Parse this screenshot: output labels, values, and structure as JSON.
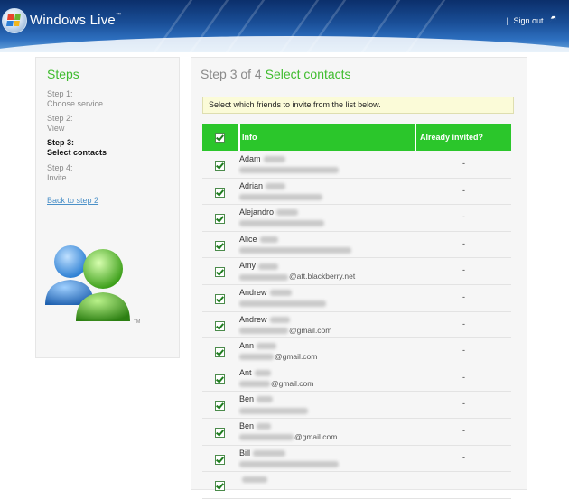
{
  "header": {
    "brand": "Windows Live",
    "brand_tm": "™",
    "separator": "|",
    "signout_label": "Sign out",
    "signout_icon": "signout-arrow-icon"
  },
  "steps": {
    "title": "Steps",
    "items": [
      {
        "label": "Step 1:",
        "desc": "Choose service",
        "active": false
      },
      {
        "label": "Step 2:",
        "desc": "View",
        "active": false
      },
      {
        "label": "Step 3:",
        "desc": "Select contacts",
        "active": true
      },
      {
        "label": "Step 4:",
        "desc": "Invite",
        "active": false
      }
    ],
    "back_link": "Back to step 2"
  },
  "main": {
    "title_prefix": "Step 3 of 4",
    "title_highlight": "Select contacts",
    "notice": "Select which friends to invite from the list below.",
    "columns": {
      "info": "Info",
      "invited": "Already invited?"
    },
    "contacts": [
      {
        "first": "Adam",
        "email_suffix": "",
        "invited": "-",
        "checked": true
      },
      {
        "first": "Adrian",
        "email_suffix": "",
        "invited": "-",
        "checked": true
      },
      {
        "first": "Alejandro",
        "email_suffix": "",
        "invited": "-",
        "checked": true
      },
      {
        "first": "Alice",
        "email_suffix": "",
        "invited": "-",
        "checked": true
      },
      {
        "first": "Amy",
        "email_suffix": "@att.blackberry.net",
        "invited": "-",
        "checked": true
      },
      {
        "first": "Andrew",
        "email_suffix": "",
        "invited": "-",
        "checked": true
      },
      {
        "first": "Andrew",
        "email_suffix": "@gmail.com",
        "invited": "-",
        "checked": true
      },
      {
        "first": "Ann",
        "email_suffix": "@gmail.com",
        "invited": "-",
        "checked": true
      },
      {
        "first": "Ant",
        "email_suffix": "@gmail.com",
        "invited": "-",
        "checked": true
      },
      {
        "first": "Ben",
        "email_suffix": "",
        "invited": "-",
        "checked": true
      },
      {
        "first": "Ben",
        "email_suffix": "@gmail.com",
        "invited": "-",
        "checked": true
      },
      {
        "first": "Bill",
        "email_suffix": "",
        "invited": "-",
        "checked": true
      },
      {
        "first": "",
        "email_suffix": "",
        "invited": "",
        "checked": true
      }
    ]
  },
  "colors": {
    "accent_green": "#2bc62b",
    "title_green": "#3fbc2e",
    "header_blue": "#1a4f98",
    "notice_bg": "#fbfbd8",
    "link_blue": "#4a90c8"
  }
}
